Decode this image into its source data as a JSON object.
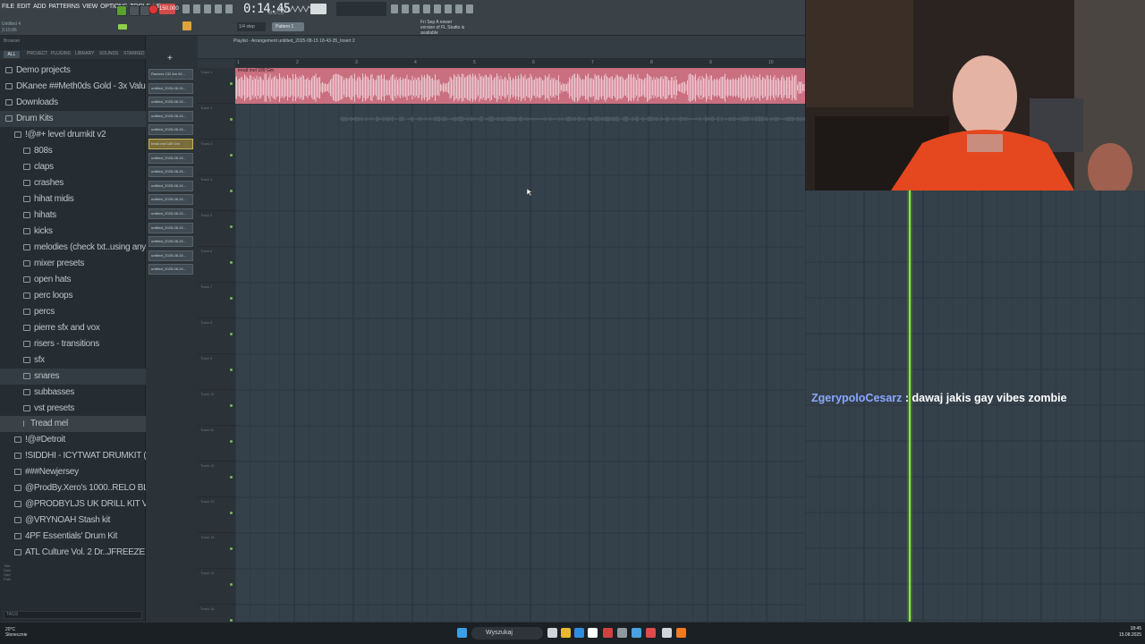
{
  "toolbar": {
    "menu_items": [
      "FILE",
      "EDIT",
      "ADD",
      "PATTERNS",
      "VIEW",
      "OPTIONS",
      "TOOLS",
      "HELP"
    ],
    "subline1": "Untitled 4",
    "subline2": "3:15:86",
    "track_label": "track 4",
    "tempo": "150.000",
    "time": "0:14:45",
    "time_sub": "M:S:CS",
    "snap": "Line",
    "snap_value": "1/4 step",
    "pattern": "Pattern 1",
    "hint": "Fri Sep  A newer version of FL Studio is available"
  },
  "browser": {
    "title": "Browser",
    "tabs": [
      "ALL",
      "PROJECT",
      "PLUGINS",
      "LIBRARY",
      "SOUNDS",
      "STARRED"
    ],
    "items": [
      {
        "label": "Demo projects",
        "indent": 0,
        "sel": false,
        "file": false
      },
      {
        "label": "DKanee ##Meth0ds Gold - 3x Value Collection",
        "indent": 0,
        "sel": false,
        "file": false
      },
      {
        "label": "Downloads",
        "indent": 0,
        "sel": false,
        "file": false
      },
      {
        "label": "Drum Kits",
        "indent": 0,
        "sel": true,
        "file": false
      },
      {
        "label": "!@#+ level drumkit v2",
        "indent": 1,
        "sel": false,
        "file": false
      },
      {
        "label": "808s",
        "indent": 2,
        "sel": false,
        "file": false
      },
      {
        "label": "claps",
        "indent": 2,
        "sel": false,
        "file": false
      },
      {
        "label": "crashes",
        "indent": 2,
        "sel": false,
        "file": false
      },
      {
        "label": "hihat midis",
        "indent": 2,
        "sel": false,
        "file": false
      },
      {
        "label": "hihats",
        "indent": 2,
        "sel": false,
        "file": false
      },
      {
        "label": "kicks",
        "indent": 2,
        "sel": false,
        "file": false
      },
      {
        "label": "melodies (check txt..using any of these)",
        "indent": 2,
        "sel": false,
        "file": false
      },
      {
        "label": "mixer presets",
        "indent": 2,
        "sel": false,
        "file": false
      },
      {
        "label": "open hats",
        "indent": 2,
        "sel": false,
        "file": false
      },
      {
        "label": "perc loops",
        "indent": 2,
        "sel": false,
        "file": false
      },
      {
        "label": "percs",
        "indent": 2,
        "sel": false,
        "file": false
      },
      {
        "label": "pierre sfx and vox",
        "indent": 2,
        "sel": false,
        "file": false
      },
      {
        "label": "risers - transitions",
        "indent": 2,
        "sel": false,
        "file": false
      },
      {
        "label": "sfx",
        "indent": 2,
        "sel": false,
        "file": false
      },
      {
        "label": "snares",
        "indent": 2,
        "sel": true,
        "file": false
      },
      {
        "label": "subbasses",
        "indent": 2,
        "sel": false,
        "file": false
      },
      {
        "label": "vst presets",
        "indent": 2,
        "sel": false,
        "file": false
      },
      {
        "label": "Tread mel",
        "indent": 2,
        "sel": false,
        "file": true
      },
      {
        "label": "!@#Detroit",
        "indent": 1,
        "sel": false,
        "file": false
      },
      {
        "label": "!SIDDHI - ICYTWAT DRUMKIT (@SIMON)",
        "indent": 1,
        "sel": false,
        "file": false
      },
      {
        "label": "###Newjersey",
        "indent": 1,
        "sel": false,
        "file": false
      },
      {
        "label": "@ProdBy.Xero's 1000..RELO BLEH MEGA KIT",
        "indent": 1,
        "sel": false,
        "file": false
      },
      {
        "label": "@PRODBYLJS UK DRILL KIT VACCINE",
        "indent": 1,
        "sel": false,
        "file": false
      },
      {
        "label": "@VRYNOAH Stash kit",
        "indent": 1,
        "sel": false,
        "file": false
      },
      {
        "label": "4PF Essentials' Drum Kit",
        "indent": 1,
        "sel": false,
        "file": false
      },
      {
        "label": "ATL Culture Vol. 2 Dr..JFREEZE & Mike Fuego",
        "indent": 1,
        "sel": false,
        "file": false
      }
    ],
    "info": [
      "Title",
      "Date",
      "Size",
      "Path"
    ],
    "search_placeholder": "TAGS"
  },
  "channels": {
    "clips": [
      "Ravines 132 Am 60...",
      "untitled_2025-08-15...",
      "untitled_2025-08-15...",
      "untitled_2025-08-15...",
      "untitled_2025-08-15...",
      "tread mel 189 Gm",
      "untitled_2025-08-15...",
      "untitled_2025-08-15...",
      "untitled_2025-08-15...",
      "untitled_2025-08-15...",
      "untitled_2025-08-15...",
      "untitled_2025-08-15...",
      "untitled_2025-08-15...",
      "untitled_2025-08-15...",
      "untitled_2025-08-15..."
    ],
    "highlight_index": 5
  },
  "playlist": {
    "title": "Playlist - Arrangement    untitled_2025-08-15 18-43-35_Insert 2",
    "ruler": [
      "1",
      "2",
      "3",
      "4",
      "5",
      "6",
      "7",
      "8",
      "9",
      "10"
    ],
    "tracks": [
      "Track 1",
      "Track 2",
      "Track 3",
      "Track 4",
      "Track 5",
      "Track 6",
      "Track 7",
      "Track 8",
      "Track 9",
      "Track 10",
      "Track 11",
      "Track 12",
      "Track 13",
      "Track 14",
      "Track 15",
      "Track 16"
    ],
    "clip_label": "tread mel 189 Gm",
    "clip_color": "#c96f80"
  },
  "chat": {
    "user": "ZgerypoloCesarz",
    "separator": " : ",
    "message": "dawaj jakis gay vibes zombie",
    "user_color": "#8aa7ff"
  },
  "taskbar": {
    "weather_temp": "20°C",
    "weather_desc": "Słonecznie",
    "search": "Wyszukaj",
    "clock_time": "18:45",
    "clock_date": "15.08.2025"
  },
  "colors": {
    "playhead": "#8be34a",
    "record": "#d83a3a",
    "play": "#5aa032"
  }
}
